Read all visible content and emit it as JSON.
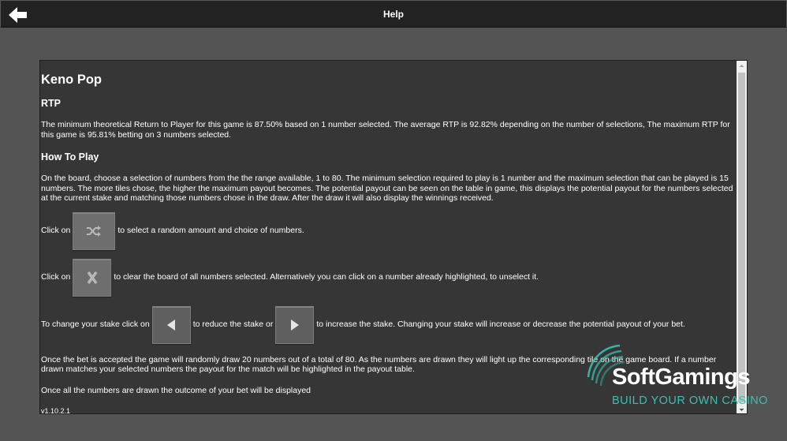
{
  "header": {
    "title": "Help"
  },
  "help": {
    "game_title": "Keno Pop",
    "rtp_heading": "RTP",
    "rtp_text": "The minimum theoretical Return to Player for this game is 87.50% based on 1 number selected. The average RTP is 92.82% depending on the number of selections, The maximum RTP for this game is 95.81% betting on 3 numbers selected.",
    "howto_heading": "How To Play",
    "howto_text": "On the board, choose a selection of numbers from the the range available, 1 to 80. The minimum selection required to play is 1 number and the maximum selection that can be played is 15 numbers. The more tiles chose, the higher the maximum payout becomes. The potential payout can be seen on the table in game, this displays the potential payout for the numbers selected at the current stake and matching those numbers chose in the draw. After the draw it will also display the winnings received.",
    "shuffle_prefix": "Click on",
    "shuffle_suffix": "to select a random amount and choice of numbers.",
    "clear_prefix": "Click on",
    "clear_suffix": "to clear the board of all numbers selected. Alternatively you can click on a number already highlighted, to unselect it.",
    "stake_prefix": "To change your stake click on",
    "stake_middle": "to reduce the stake or",
    "stake_suffix": "to increase the stake. Changing your stake will increase or decrease the potential payout of your bet.",
    "draw_text": "Once the bet is accepted the game will randomly draw 20 numbers out of a total of 80. As the numbers are drawn they will light up the corresponding tile on the game board. If a number drawn matches your selected numbers the payout for the match will be highlighted in the payout table.",
    "outcome_text": "Once all the numbers are drawn the outcome of your bet will be displayed",
    "version": "v1.10.2.1"
  },
  "icons": {
    "back": "back-arrow-icon",
    "shuffle": "shuffle-icon",
    "clear": "clear-x-icon",
    "decrease": "left-arrow-icon",
    "increase": "right-arrow-icon"
  },
  "watermark": {
    "name": "SoftGamings",
    "tagline": "BUILD YOUR OWN CASINO"
  },
  "colors": {
    "topbar": "#222222",
    "background": "#545454",
    "panel": "#363636",
    "button": "#6e6e6e",
    "brand_accent": "#35c1b3"
  }
}
